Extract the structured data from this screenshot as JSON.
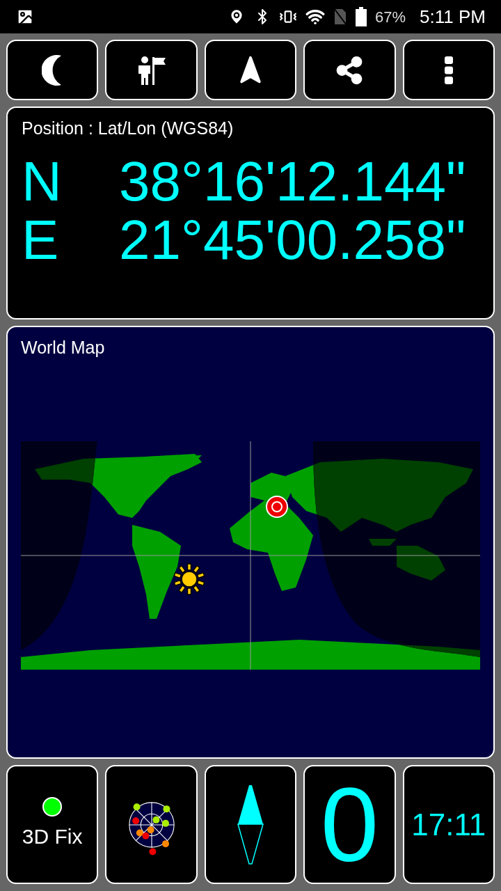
{
  "status_bar": {
    "battery": "67%",
    "time": "5:11 PM"
  },
  "position": {
    "title": "Position : Lat/Lon (WGS84)",
    "rows": [
      {
        "hemisphere": "N",
        "value": "38°16'12.144\""
      },
      {
        "hemisphere": "E",
        "value": "21°45'00.258\""
      }
    ]
  },
  "map": {
    "title": "World Map"
  },
  "fix": {
    "label": "3D Fix",
    "color": "#00ff00"
  },
  "satellites": [
    {
      "color": "#aaee00"
    },
    {
      "color": "#aaee00"
    },
    {
      "color": "#ee0000"
    },
    {
      "color": "#aaee00"
    },
    {
      "color": "#aaee00"
    },
    {
      "color": "#ff8800"
    },
    {
      "color": "#ff8800"
    },
    {
      "color": "#ee0000"
    },
    {
      "color": "#ff8800"
    },
    {
      "color": "#ee0000"
    }
  ],
  "speed": "0",
  "clock": "17:11"
}
